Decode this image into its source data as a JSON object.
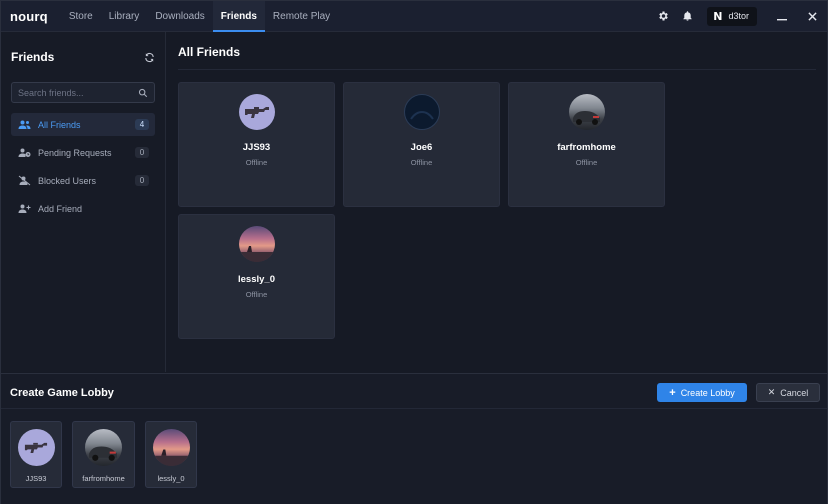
{
  "app": {
    "logo": "nourq"
  },
  "nav": [
    {
      "label": "Store",
      "active": false
    },
    {
      "label": "Library",
      "active": false
    },
    {
      "label": "Downloads",
      "active": false
    },
    {
      "label": "Friends",
      "active": true
    },
    {
      "label": "Remote Play",
      "active": false
    }
  ],
  "user": {
    "badge": "N",
    "username": "d3tor"
  },
  "sidebar": {
    "title": "Friends",
    "search_placeholder": "Search friends...",
    "items": [
      {
        "label": "All Friends",
        "count": "4",
        "icon": "users-icon",
        "active": true
      },
      {
        "label": "Pending Requests",
        "count": "0",
        "icon": "user-clock-icon",
        "active": false
      },
      {
        "label": "Blocked Users",
        "count": "0",
        "icon": "user-slash-icon",
        "active": false
      },
      {
        "label": "Add Friend",
        "icon": "user-plus-icon",
        "active": false
      }
    ]
  },
  "main": {
    "title": "All Friends",
    "friends": [
      {
        "name": "JJS93",
        "status": "Offline",
        "avatar": "gun"
      },
      {
        "name": "Joe6",
        "status": "Offline",
        "avatar": "dark"
      },
      {
        "name": "farfromhome",
        "status": "Offline",
        "avatar": "car"
      },
      {
        "name": "lessly_0",
        "status": "Offline",
        "avatar": "sunset"
      }
    ]
  },
  "lobby": {
    "title": "Create Game Lobby",
    "create_label": "Create Lobby",
    "cancel_label": "Cancel",
    "members": [
      {
        "name": "JJS93",
        "avatar": "gun"
      },
      {
        "name": "farfromhome",
        "avatar": "car"
      },
      {
        "name": "lessly_0",
        "avatar": "sunset"
      }
    ]
  },
  "colors": {
    "accent": "#2f84e8",
    "background": "#161a25",
    "card": "#252a37"
  }
}
